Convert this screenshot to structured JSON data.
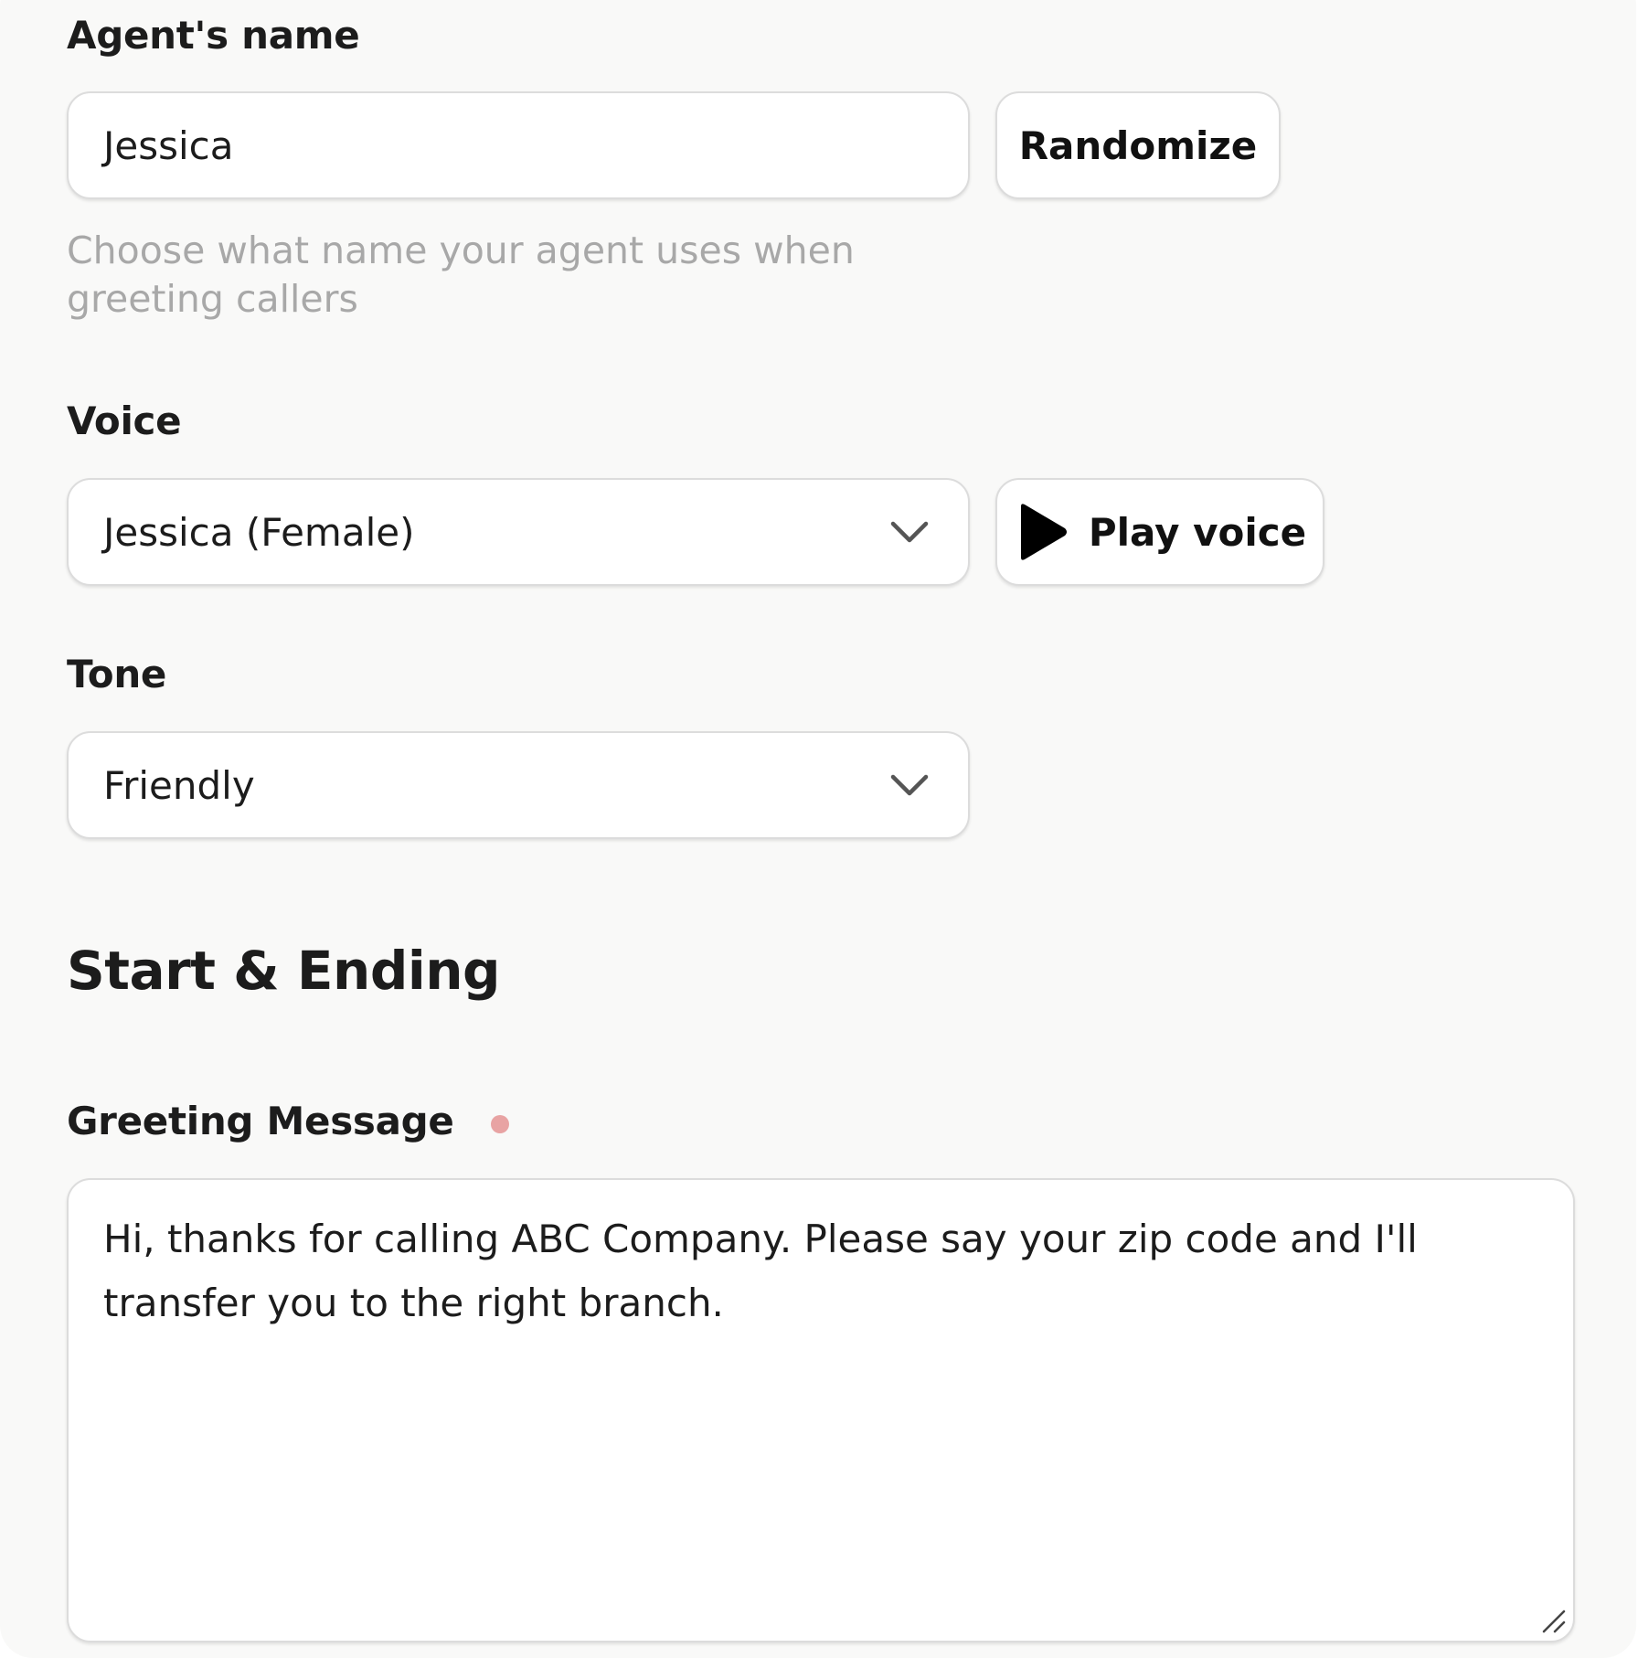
{
  "agent_name": {
    "label": "Agent's name",
    "value": "Jessica",
    "randomize_label": "Randomize",
    "hint": "Choose what name your agent uses when greeting callers"
  },
  "voice": {
    "label": "Voice",
    "selected": "Jessica (Female)",
    "play_label": "Play voice"
  },
  "tone": {
    "label": "Tone",
    "selected": "Friendly"
  },
  "start_ending": {
    "title": "Start & Ending",
    "greeting_label": "Greeting Message",
    "greeting_text": "Hi, thanks for calling ABC Company. Please say your zip code and I'll transfer you to the right branch."
  },
  "icons": {
    "dropdown": "chevron-down-icon",
    "play": "play-icon",
    "required": "required-indicator",
    "resize": "resize-handle-icon"
  },
  "colors": {
    "background": "#f9f9f8",
    "hint_text": "#a8a8a8",
    "required_dot": "#e8a3a3",
    "border": "#dcdcdc"
  }
}
